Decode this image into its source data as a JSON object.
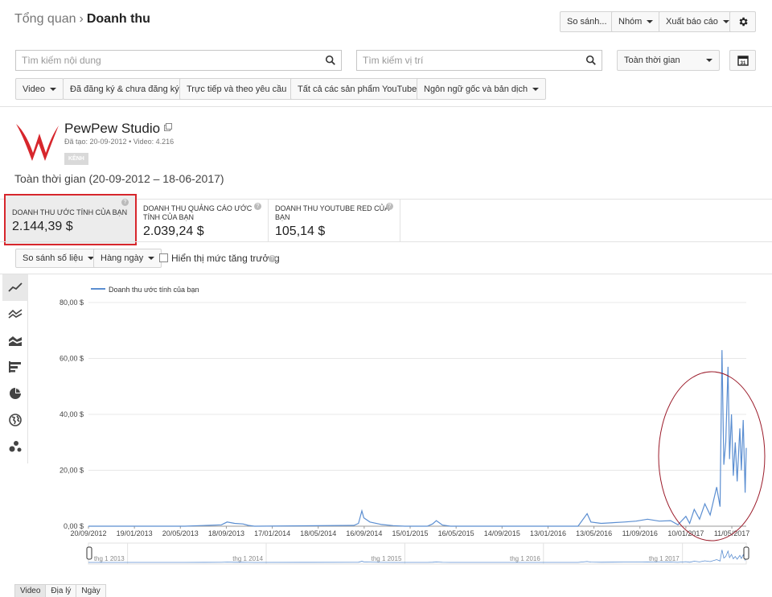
{
  "breadcrumb": {
    "parent": "Tổng quan",
    "separator": "›",
    "current": "Doanh thu"
  },
  "header_buttons": {
    "compare": "So sánh...",
    "groups": "Nhóm",
    "export": "Xuất báo cáo"
  },
  "search": {
    "content_placeholder": "Tìm kiếm nội dung",
    "location_placeholder": "Tìm kiếm vị trí"
  },
  "period_select": {
    "value": "Toàn thời gian"
  },
  "calendar": {
    "day": "31"
  },
  "filters": [
    "Video",
    "Đã đăng ký & chưa đăng ký",
    "Trực tiếp và theo yêu cầu",
    "Tất cả các sản phẩm YouTube",
    "Ngôn ngữ gốc và bản dịch"
  ],
  "channel": {
    "name": "PewPew Studio",
    "created": "Đã tạo: 20-09-2012",
    "bullet": "•",
    "videos": "Video: 4.216",
    "badge": "KÊNH"
  },
  "range_label": "Toàn thời gian (20-09-2012 – 18-06-2017)",
  "metrics": [
    {
      "label": "DOANH THU ƯỚC TÍNH CỦA BẠN",
      "value": "2.144,39 $"
    },
    {
      "label": "DOANH THU QUẢNG CÁO ƯỚC TÍNH CỦA BẠN",
      "value": "2.039,24 $"
    },
    {
      "label": "DOANH THU YOUTUBE RED CỦA BẠN",
      "value": "105,14 $"
    }
  ],
  "help_glyph": "?",
  "controls": {
    "compare_metric": "So sánh số liệu",
    "granularity": "Hàng ngày",
    "growth": "Hiển thị mức tăng trưởng"
  },
  "bottom_tabs": [
    "Video",
    "Địa lý",
    "Ngày"
  ],
  "colors": {
    "series": "#5b8ed1",
    "highlight": "#d7262c",
    "ellipse": "#9b1b2a"
  },
  "chart_data": {
    "type": "line",
    "legend": [
      "Doanh thu ước tính của bạn"
    ],
    "legend_position": "top-left",
    "y_ticks": [
      "0,00 $",
      "20,00 $",
      "40,00 $",
      "60,00 $",
      "80,00 $"
    ],
    "ylim": [
      0,
      80
    ],
    "x_ticks": [
      "20/09/2012",
      "19/01/2013",
      "20/05/2013",
      "18/09/2013",
      "17/01/2014",
      "18/05/2014",
      "16/09/2014",
      "15/01/2015",
      "16/05/2015",
      "14/09/2015",
      "13/01/2016",
      "13/05/2016",
      "11/09/2016",
      "10/01/2017",
      "11/05/2017"
    ],
    "xlim": [
      "20/09/2012",
      "18/06/2017"
    ],
    "grid": true,
    "series": [
      {
        "name": "Doanh thu ước tính của bạn",
        "points": [
          [
            "20/09/2012",
            0
          ],
          [
            "01/06/2013",
            0
          ],
          [
            "05/09/2013",
            0.5
          ],
          [
            "20/09/2013",
            1.5
          ],
          [
            "10/10/2013",
            1.0
          ],
          [
            "01/11/2013",
            0.8
          ],
          [
            "15/11/2013",
            0.3
          ],
          [
            "01/12/2013",
            0
          ],
          [
            "20/08/2014",
            0.3
          ],
          [
            "01/09/2014",
            1.0
          ],
          [
            "10/09/2014",
            5.5
          ],
          [
            "15/09/2014",
            3.0
          ],
          [
            "01/10/2014",
            1.5
          ],
          [
            "01/11/2014",
            0.6
          ],
          [
            "01/12/2014",
            0.2
          ],
          [
            "01/01/2015",
            0
          ],
          [
            "01/03/2015",
            0
          ],
          [
            "15/03/2015",
            0.8
          ],
          [
            "25/03/2015",
            2.0
          ],
          [
            "10/04/2015",
            0.4
          ],
          [
            "01/05/2015",
            0
          ],
          [
            "01/04/2016",
            0
          ],
          [
            "25/04/2016",
            4.5
          ],
          [
            "05/05/2016",
            1.5
          ],
          [
            "01/06/2016",
            1.0
          ],
          [
            "01/08/2016",
            1.5
          ],
          [
            "01/09/2016",
            1.8
          ],
          [
            "01/10/2016",
            2.5
          ],
          [
            "01/11/2016",
            1.8
          ],
          [
            "01/12/2016",
            2.0
          ],
          [
            "20/12/2016",
            0.5
          ],
          [
            "10/01/2017",
            3.5
          ],
          [
            "20/01/2017",
            1.0
          ],
          [
            "01/02/2017",
            6.0
          ],
          [
            "15/02/2017",
            2.5
          ],
          [
            "01/03/2017",
            8.0
          ],
          [
            "15/03/2017",
            4.0
          ],
          [
            "01/04/2017",
            14.0
          ],
          [
            "10/04/2017",
            7.0
          ],
          [
            "15/04/2017",
            63.0
          ],
          [
            "20/04/2017",
            22.0
          ],
          [
            "25/04/2017",
            30.0
          ],
          [
            "01/05/2017",
            57.0
          ],
          [
            "05/05/2017",
            24.0
          ],
          [
            "10/05/2017",
            40.0
          ],
          [
            "15/05/2017",
            18.0
          ],
          [
            "20/05/2017",
            30.0
          ],
          [
            "25/05/2017",
            16.0
          ],
          [
            "01/06/2017",
            35.0
          ],
          [
            "05/06/2017",
            20.0
          ],
          [
            "10/06/2017",
            38.0
          ],
          [
            "15/06/2017",
            12.0
          ],
          [
            "18/06/2017",
            28.0
          ]
        ]
      }
    ],
    "overview_labels": [
      "thg 1 2013",
      "thg 1 2014",
      "thg 1 2015",
      "thg 1 2016",
      "thg 1 2017"
    ]
  }
}
